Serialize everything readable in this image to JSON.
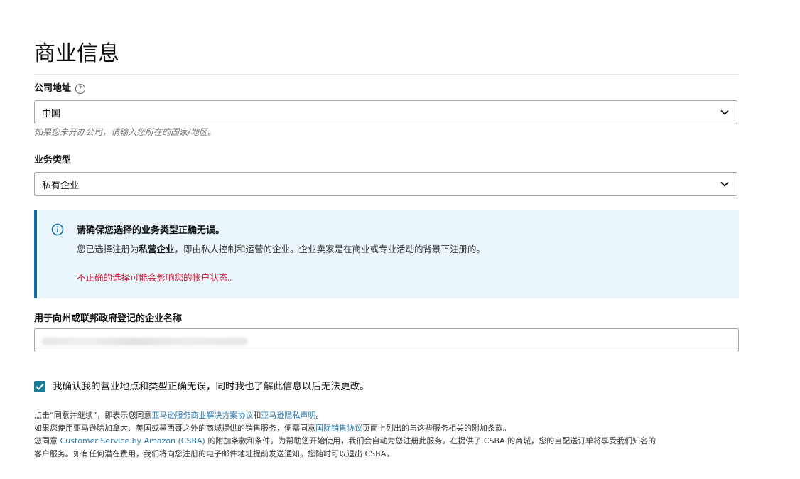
{
  "page": {
    "title": "商业信息"
  },
  "company_location": {
    "label": "公司地址",
    "help_glyph": "?",
    "selected": "中国",
    "hint": "如果您未开办公司，请输入您所在的国家/地区。"
  },
  "business_type": {
    "label": "业务类型",
    "selected": "私有企业"
  },
  "info_box": {
    "title": "请确保您选择的业务类型正确无误。",
    "body_prefix": "您已选择注册为",
    "body_strong": "私营企业",
    "body_suffix": "，即由私人控制和运营的企业。企业卖家是在商业或专业活动的背景下注册的。",
    "warning": "不正确的选择可能会影响您的帐户状态。"
  },
  "business_name": {
    "label": "用于向州或联邦政府登记的企业名称"
  },
  "confirm": {
    "checked": true,
    "text": "我确认我的营业地点和类型正确无误，同时我也了解此信息以后无法更改。"
  },
  "legal": {
    "line1_prefix": "点击“同意并继续”，即表示您同意",
    "line1_link1": "亚马逊服务商业解决方案协议",
    "line1_mid": "和",
    "line1_link2": "亚马逊隐私声明",
    "line1_suffix": "。",
    "line2_prefix": "如果您使用亚马逊除加拿大、美国或墨西哥之外的商城提供的销售服务，便需同意",
    "line2_link": "国际销售协议",
    "line2_suffix": "页面上列出的与这些服务相关的附加条款。",
    "line3_prefix": "您同意 ",
    "line3_link": "Customer Service by Amazon (CSBA)",
    "line3_suffix": " 的附加条款和条件。为帮助您开始使用，我们会自动为您注册此服务。在提供了 CSBA 的商城，您的自配送订单将享受我们知名的",
    "line4": "客户服务。如有任何潜在费用，我们将向您注册的电子邮件地址提前发送通知。您随时可以退出 CSBA。"
  },
  "colors": {
    "accent": "#0f6fa8",
    "info_bg": "#eaf6fb",
    "warning": "#cc1c39",
    "checkbox": "#1a7b97",
    "link": "#2a7ab0"
  }
}
